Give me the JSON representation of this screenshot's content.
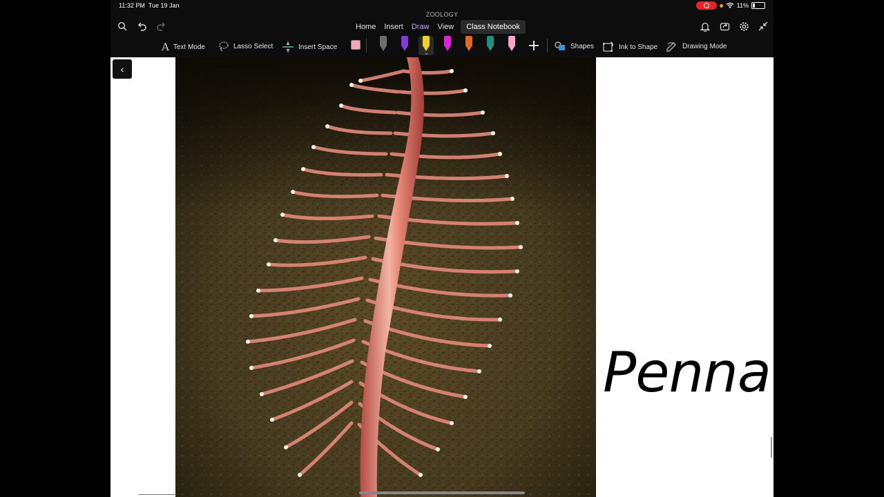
{
  "status": {
    "time": "11:32 PM",
    "date": "Tue 19 Jan",
    "battery": "11%"
  },
  "app_title": "ZOOLOGY",
  "ribbon": {
    "tabs": [
      {
        "label": "Home"
      },
      {
        "label": "Insert"
      },
      {
        "label": "Draw",
        "active": true
      },
      {
        "label": "View"
      },
      {
        "label": "Class Notebook"
      }
    ]
  },
  "draw_tools": {
    "text_mode": "Text Mode",
    "lasso_select": "Lasso Select",
    "insert_space": "Insert Space",
    "shapes": "Shapes",
    "ink_to_shape": "Ink to Shape",
    "drawing_mode": "Drawing Mode",
    "pens": [
      {
        "color": "#6d6d6d"
      },
      {
        "color": "#7b3fd1"
      },
      {
        "color": "#f0d12a",
        "selected": true
      },
      {
        "color": "#e020d8"
      },
      {
        "color": "#e0692a"
      },
      {
        "color": "#1f8f7c"
      },
      {
        "color": "#f6a5c9"
      }
    ]
  },
  "page": {
    "heading_text": "Pennat"
  },
  "colors": {
    "accent": "#c9a7ff",
    "record": "#e0262b"
  }
}
